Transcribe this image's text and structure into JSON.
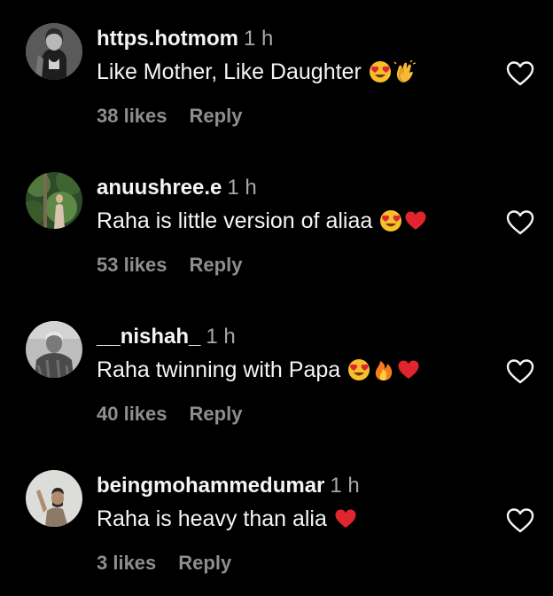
{
  "comments": [
    {
      "username": "https.hotmom",
      "time": "1 h",
      "text": "Like Mother, Like Daughter",
      "emojis": [
        "heart-eyes",
        "clapping-hands"
      ],
      "likes": "38 likes",
      "reply_label": "Reply"
    },
    {
      "username": "anuushree.e",
      "time": "1 h",
      "text": "Raha is little version of aliaa",
      "emojis": [
        "heart-eyes",
        "red-heart"
      ],
      "likes": "53 likes",
      "reply_label": "Reply"
    },
    {
      "username": "__nishah_",
      "time": "1 h",
      "text": "Raha twinning with Papa",
      "emojis": [
        "heart-eyes",
        "fire",
        "red-heart"
      ],
      "likes": "40 likes",
      "reply_label": "Reply"
    },
    {
      "username": "beingmohammedumar",
      "time": "1 h",
      "text": "Raha is heavy than alia",
      "emojis": [
        "red-heart"
      ],
      "likes": "3 likes",
      "reply_label": "Reply"
    }
  ],
  "colors": {
    "background": "#000000",
    "primary_text": "#f5f5f5",
    "secondary_text": "#a8a8a8",
    "meta_text": "#8e8e8e",
    "heart_red": "#e0252f"
  }
}
